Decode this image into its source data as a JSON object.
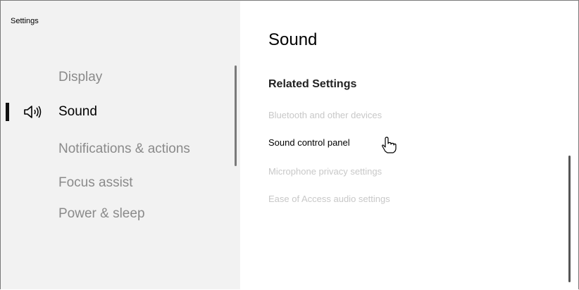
{
  "window": {
    "title": "Settings"
  },
  "sidebar": {
    "items": [
      {
        "label": "Display",
        "selected": false
      },
      {
        "label": "Sound",
        "selected": true,
        "icon": "speaker-icon"
      },
      {
        "label": "Notifications & actions",
        "selected": false
      },
      {
        "label": "Focus assist",
        "selected": false
      },
      {
        "label": "Power & sleep",
        "selected": false
      }
    ]
  },
  "main": {
    "title": "Sound",
    "related_settings": {
      "heading": "Related Settings",
      "links": [
        {
          "label": "Bluetooth and other devices",
          "state": "disabled"
        },
        {
          "label": "Sound control panel",
          "state": "hovered"
        },
        {
          "label": "Microphone privacy settings",
          "state": "disabled"
        },
        {
          "label": "Ease of Access audio settings",
          "state": "disabled"
        }
      ]
    }
  },
  "cursor": {
    "icon": "hand-pointer-icon"
  },
  "colors": {
    "sidebar_bg": "#f2f2f2",
    "inactive_text": "#8a8a8a",
    "disabled_link": "#c8c8c8",
    "selection_bar": "#111111"
  }
}
